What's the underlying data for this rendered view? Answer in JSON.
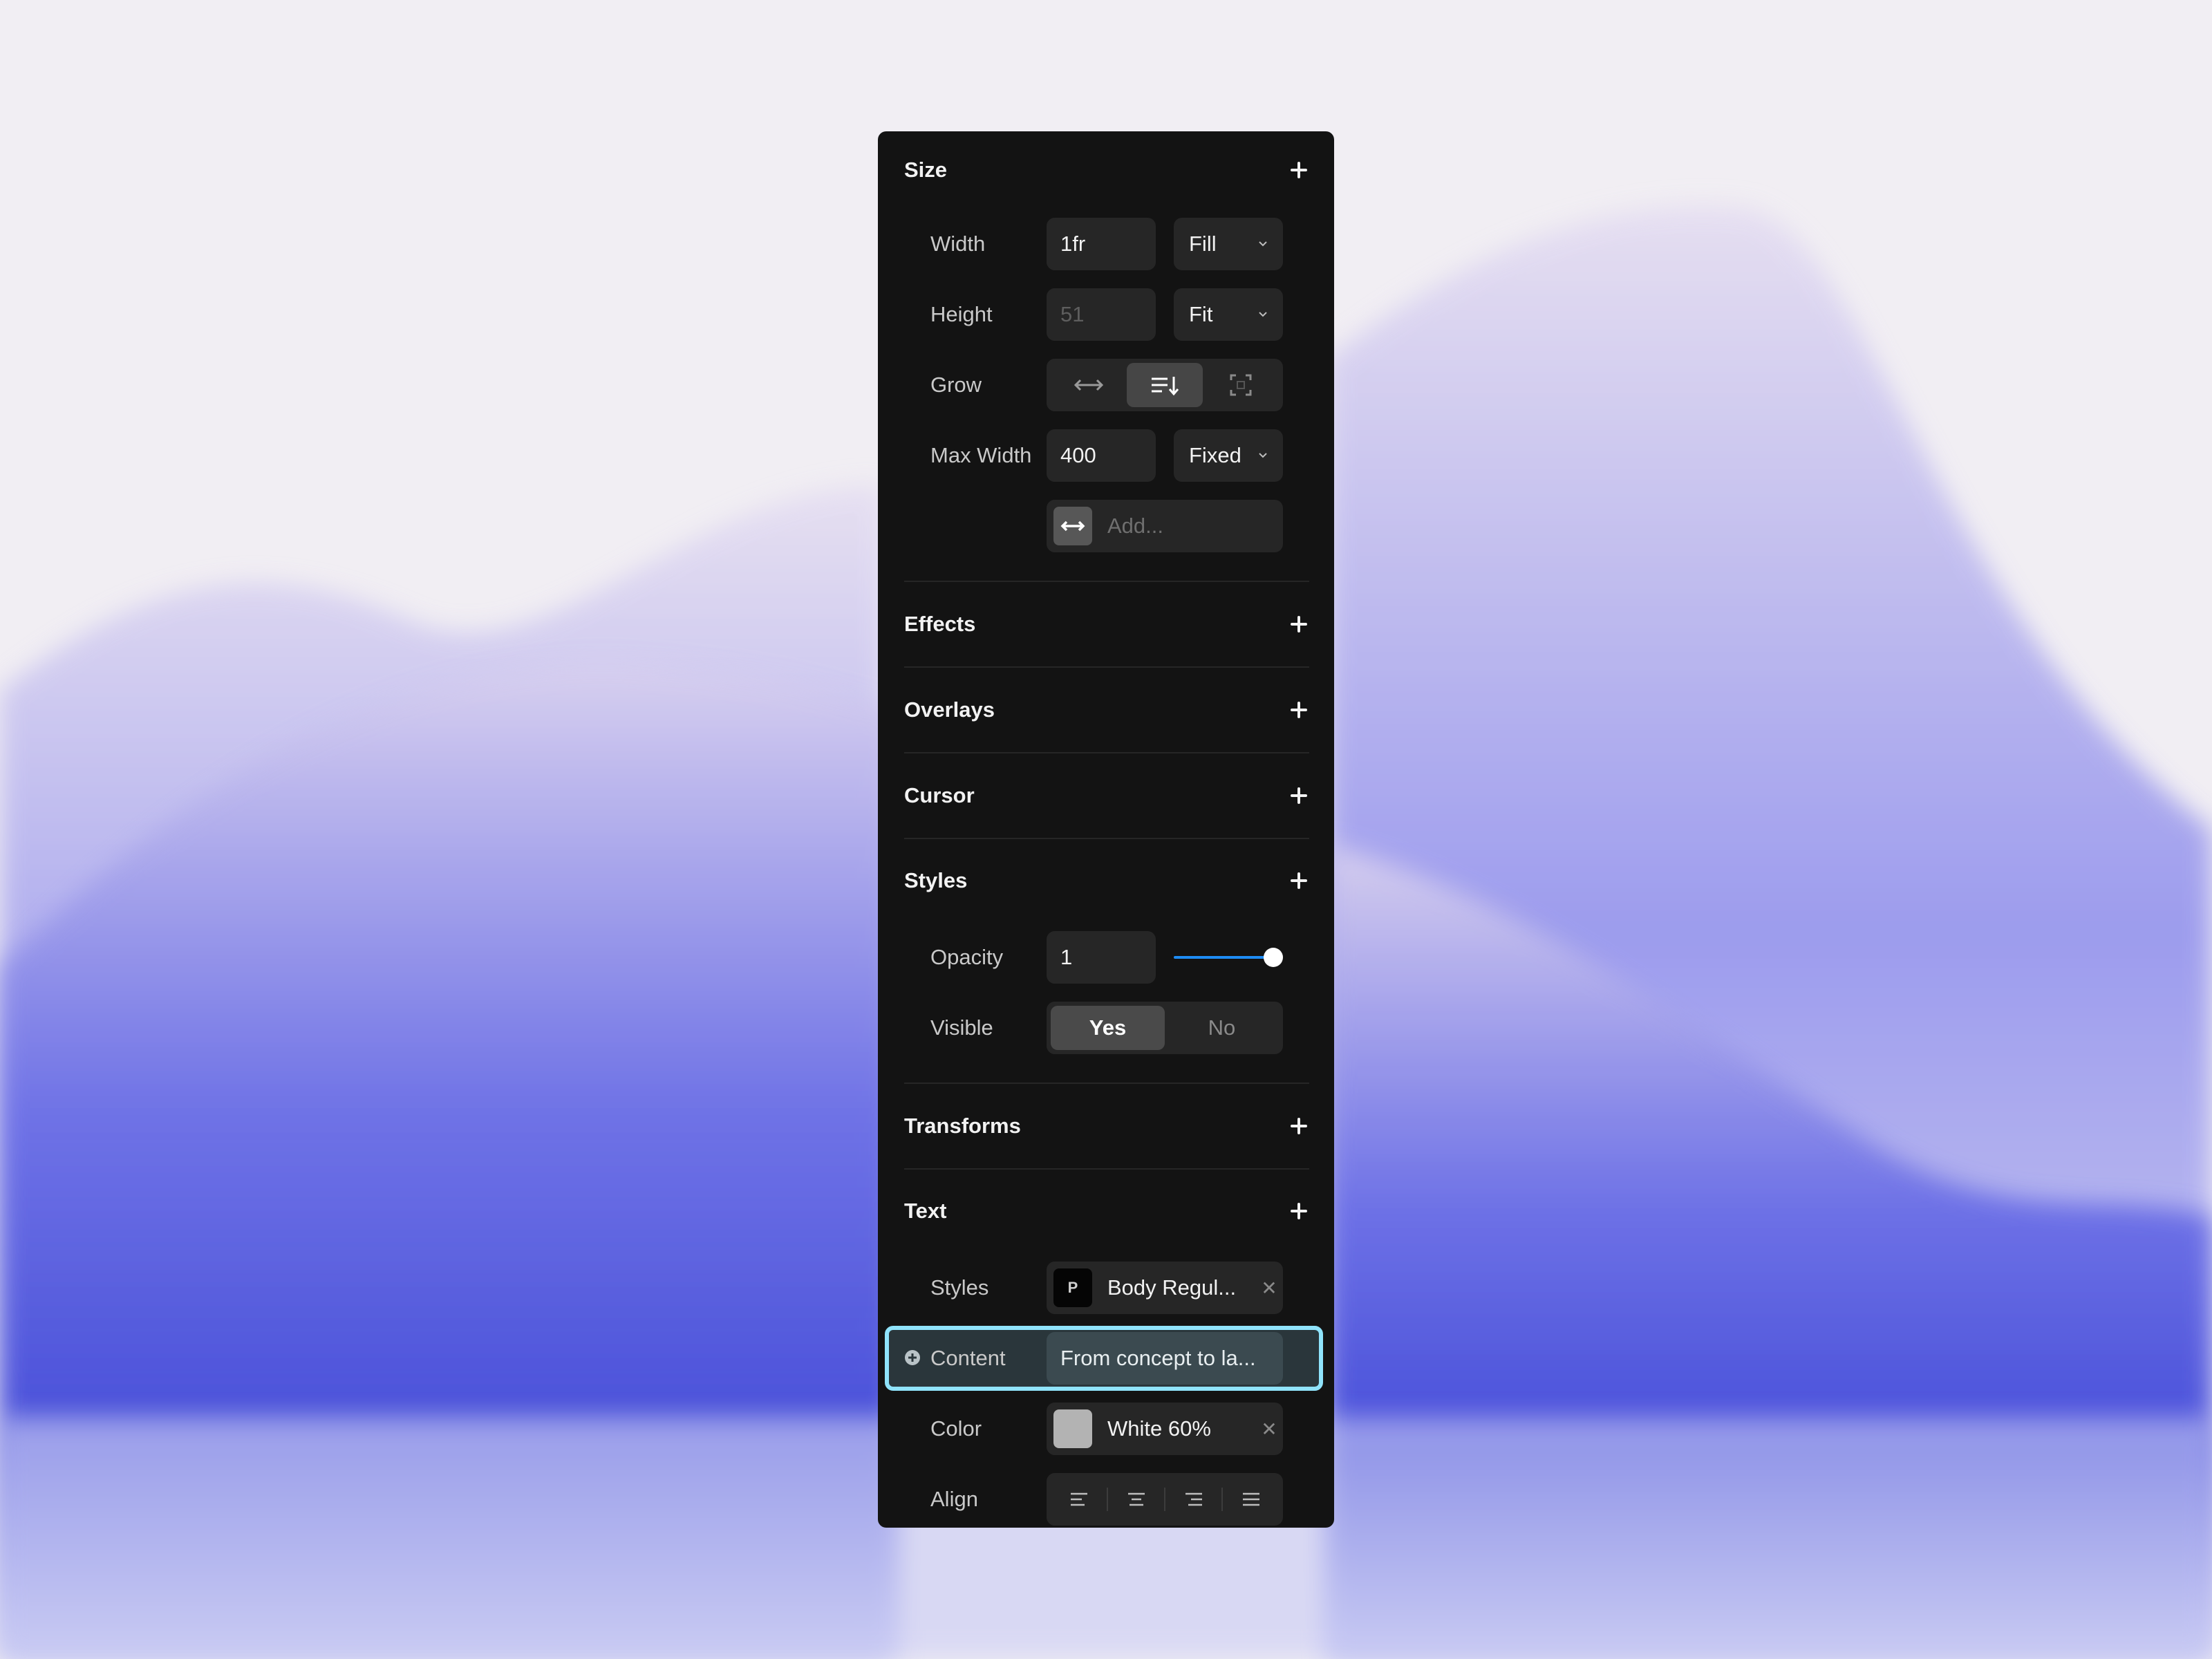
{
  "size": {
    "title": "Size",
    "width": {
      "label": "Width",
      "value": "1fr",
      "mode": "Fill"
    },
    "height": {
      "label": "Height",
      "value": "51",
      "mode": "Fit"
    },
    "grow": {
      "label": "Grow",
      "options": [
        "horizontal-arrows-icon",
        "wrap-text-icon",
        "corners-icon"
      ],
      "selected_index": 1
    },
    "max_width": {
      "label": "Max Width",
      "value": "400",
      "mode": "Fixed"
    },
    "add": {
      "placeholder": "Add..."
    }
  },
  "effects": {
    "title": "Effects"
  },
  "overlays": {
    "title": "Overlays"
  },
  "cursor": {
    "title": "Cursor"
  },
  "styles": {
    "title": "Styles",
    "opacity": {
      "label": "Opacity",
      "value": "1",
      "slider_fraction": 1.0
    },
    "visible": {
      "label": "Visible",
      "yes": "Yes",
      "no": "No",
      "selected": "Yes"
    }
  },
  "transforms": {
    "title": "Transforms"
  },
  "text": {
    "title": "Text",
    "styles": {
      "label": "Styles",
      "chip": "P",
      "value": "Body Regul..."
    },
    "content": {
      "label": "Content",
      "value": "From concept to la..."
    },
    "color": {
      "label": "Color",
      "value": "White 60%",
      "swatch": "#b3b3b3"
    },
    "align": {
      "label": "Align",
      "options": [
        "align-left-icon",
        "align-center-icon",
        "align-right-icon",
        "align-justify-icon"
      ]
    }
  },
  "colors": {
    "accent": "#1e8cf4",
    "highlight": "#8fe3fb",
    "panel": "#131313"
  }
}
